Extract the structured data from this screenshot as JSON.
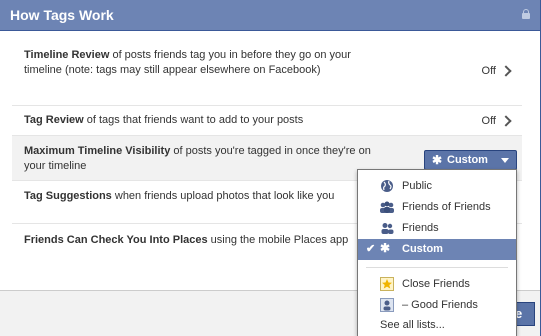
{
  "dialog": {
    "title": "How Tags Work",
    "lock_icon": "lock-icon"
  },
  "rows": [
    {
      "bold": "Timeline Review",
      "text": " of posts friends tag you in before they go on your timeline (note: tags may still appear elsewhere on Facebook)",
      "value": "Off"
    },
    {
      "bold": "Tag Review",
      "text": " of tags that friends want to add to your posts",
      "value": "Off"
    },
    {
      "bold": "Maximum Timeline Visibility",
      "text": " of posts you're tagged in once they're on your timeline",
      "value": "Custom"
    },
    {
      "bold": "Tag Suggestions",
      "text": " when friends upload photos that look like you"
    },
    {
      "bold": "Friends Can Check You Into Places",
      "text": " using the mobile Places app"
    }
  ],
  "dropdown": {
    "items": [
      {
        "label": "Public",
        "icon": "globe-icon"
      },
      {
        "label": "Friends of Friends",
        "icon": "friends-of-friends-icon"
      },
      {
        "label": "Friends",
        "icon": "friends-icon"
      },
      {
        "label": "Custom",
        "icon": "gear-icon",
        "selected": true
      }
    ],
    "lists": [
      {
        "label": "Close Friends",
        "icon": "star-icon"
      },
      {
        "label": "– Good Friends",
        "icon": "person-list-icon"
      }
    ],
    "see_all": "See all lists..."
  },
  "footer": {
    "button_label": "e"
  },
  "colors": {
    "title_bar": "#6d84b4",
    "button": "#5b74a8",
    "selected_item": "#6d84b4"
  }
}
